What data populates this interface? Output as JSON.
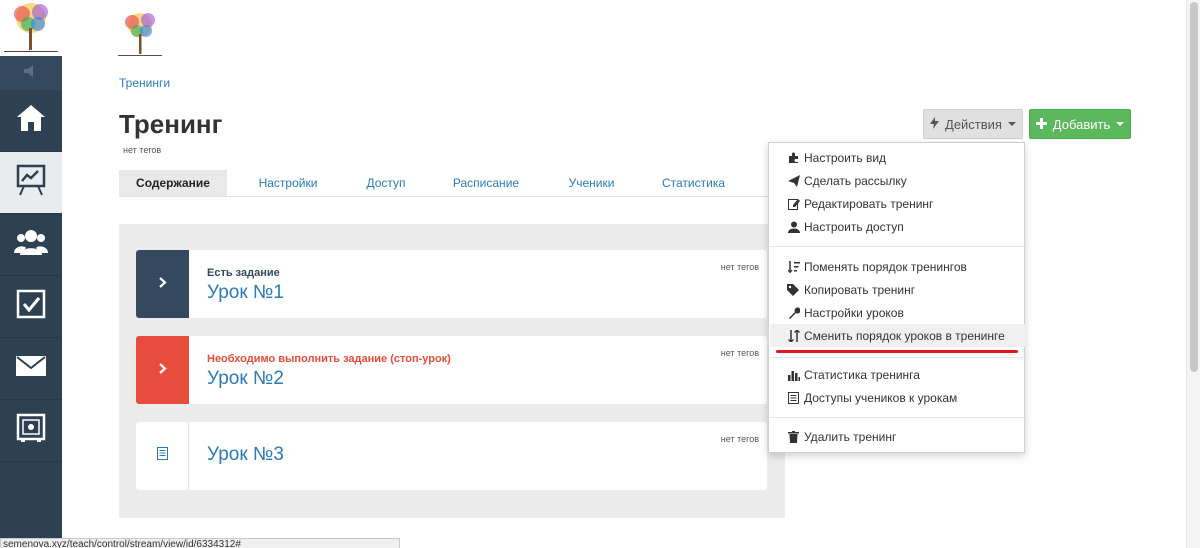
{
  "sidebar": {
    "items": [
      {
        "icon": "home-icon"
      },
      {
        "icon": "presentation-chart-icon",
        "active": true
      },
      {
        "icon": "users-icon"
      },
      {
        "icon": "checkbox-icon"
      },
      {
        "icon": "mail-icon"
      },
      {
        "icon": "safe-icon"
      }
    ]
  },
  "breadcrumb": "Тренинги",
  "page": {
    "title": "Тренинг",
    "tags": "нет тегов"
  },
  "buttons": {
    "actions_label": "Действия",
    "add_label": "Добавить"
  },
  "tabs": [
    "Содержание",
    "Настройки",
    "Доступ",
    "Расписание",
    "Ученики",
    "Статистика"
  ],
  "lessons": [
    {
      "status": "Есть задание",
      "status_color": "#34495e",
      "title": "Урок №1",
      "tags": "нет тегов"
    },
    {
      "status": "Необходимо выполнить задание (стоп-урок)",
      "status_color": "#e74c3c",
      "title": "Урок №2",
      "tags": "нет тегов"
    },
    {
      "title": "Урок №3",
      "tags": "нет тегов"
    }
  ],
  "dropdown": {
    "items": [
      "Настроить вид",
      "Сделать рассылку",
      "Редактировать тренинг",
      "Настроить доступ",
      "Поменять порядок тренингов",
      "Копировать тренинг",
      "Настройки уроков",
      "Сменить порядок уроков в тренинге",
      "Статистика тренинга",
      "Доступы учеников к урокам",
      "Удалить тренинг"
    ]
  },
  "status_url": "semenova.xyz/teach/control/stream/view/id/6334312#",
  "colors": {
    "sidebar": "#2d4152",
    "link": "#2b7bb9",
    "add_button": "#5cb85c",
    "highlight_underline": "#e0181b"
  }
}
